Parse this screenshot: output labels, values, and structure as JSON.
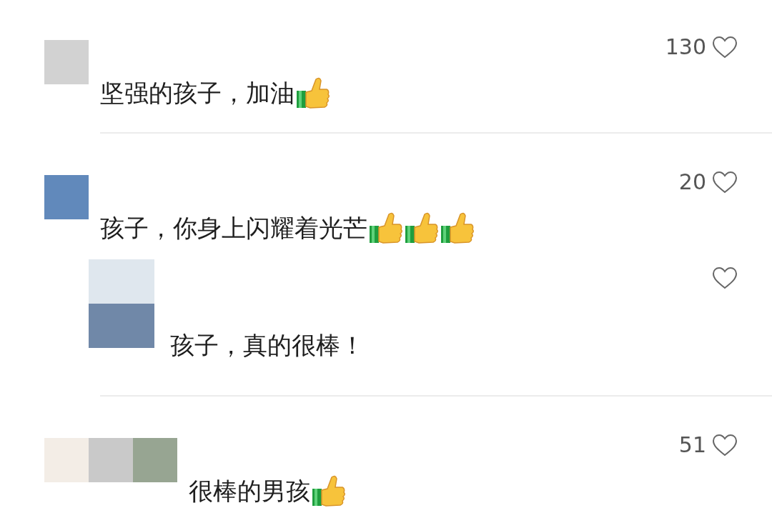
{
  "comments": [
    {
      "avatar": [
        {
          "color": "#d2d2d2"
        }
      ],
      "text": "坚强的孩子，加油",
      "emoji": [
        {
          "kind": "thumbs-up"
        }
      ],
      "likes": "130"
    },
    {
      "avatar": [
        {
          "color": "#6189bb"
        }
      ],
      "text": "孩子，你身上闪耀着光芒",
      "emoji": [
        {
          "kind": "thumbs-up"
        },
        {
          "kind": "thumbs-up"
        },
        {
          "kind": "thumbs-up"
        }
      ],
      "likes": "20",
      "replies": [
        {
          "avatar": [
            {
              "color": "#dfe7ee"
            },
            {
              "color": "#7088a8"
            }
          ],
          "text": "孩子，真的很棒！"
        }
      ]
    },
    {
      "avatar": [
        {
          "color": "#f3ede6"
        },
        {
          "color": "#c9c9c9"
        },
        {
          "color": "#97a592"
        }
      ],
      "text": "很棒的男孩",
      "emoji": [
        {
          "kind": "thumbs-up"
        }
      ],
      "likes": "51"
    }
  ]
}
